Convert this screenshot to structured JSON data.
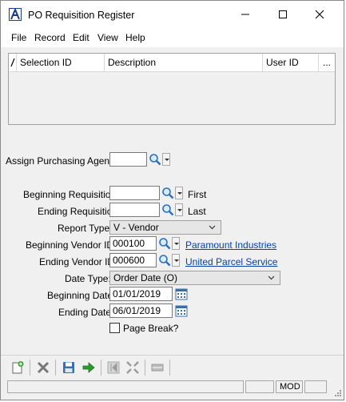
{
  "window": {
    "title": "PO Requisition Register"
  },
  "menu": [
    "File",
    "Record",
    "Edit",
    "View",
    "Help"
  ],
  "grid": {
    "columns": [
      "Selection ID",
      "Description",
      "User ID",
      "..."
    ]
  },
  "form": {
    "agent_label": "Assign Purchasing Agent:",
    "agent_value": "",
    "begin_req_label": "Beginning Requisition",
    "begin_req_value": "",
    "begin_req_hint": "First",
    "end_req_label": "Ending Requisition",
    "end_req_value": "",
    "end_req_hint": "Last",
    "report_type_label": "Report Type:",
    "report_type_value": "V - Vendor",
    "begin_vendor_label": "Beginning Vendor ID:",
    "begin_vendor_value": "000100",
    "begin_vendor_name": "Paramount Industries",
    "end_vendor_label": "Ending Vendor ID:",
    "end_vendor_value": "000600",
    "end_vendor_name": "United Parcel Service",
    "date_type_label": "Date Type:",
    "date_type_value": "Order Date (O)",
    "begin_date_label": "Beginning Date:",
    "begin_date_value": "01/01/2019",
    "end_date_label": "Ending Date:",
    "end_date_value": "06/01/2019",
    "page_break_label": "Page Break?",
    "page_break_checked": false
  },
  "status": {
    "mode": "MOD"
  },
  "colors": {
    "link": "#0b3ea8",
    "accent": "#1a3a8a"
  }
}
